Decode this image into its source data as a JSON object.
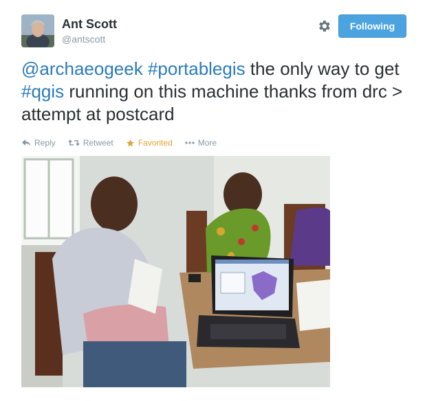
{
  "user": {
    "name": "Ant Scott",
    "handle": "@antscott"
  },
  "follow_button": {
    "label": "Following"
  },
  "tweet": {
    "parts": [
      {
        "text": "@archaeogeek",
        "kind": "mention"
      },
      {
        "text": " ",
        "kind": "text"
      },
      {
        "text": "#portablegis",
        "kind": "hashtag"
      },
      {
        "text": " the only way to get ",
        "kind": "text"
      },
      {
        "text": "#qgis",
        "kind": "hashtag"
      },
      {
        "text": " running on this machine thanks from drc > attempt at postcard",
        "kind": "text"
      }
    ]
  },
  "actions": {
    "reply": "Reply",
    "retweet": "Retweet",
    "favorite": "Favorited",
    "more": "More"
  },
  "colors": {
    "link": "#2b7bb9",
    "follow_bg": "#4ba3e0",
    "favorited": "#e1a233",
    "muted": "#8899a6"
  },
  "icons": [
    "gear-icon",
    "reply-icon",
    "retweet-icon",
    "star-icon",
    "more-icon"
  ]
}
